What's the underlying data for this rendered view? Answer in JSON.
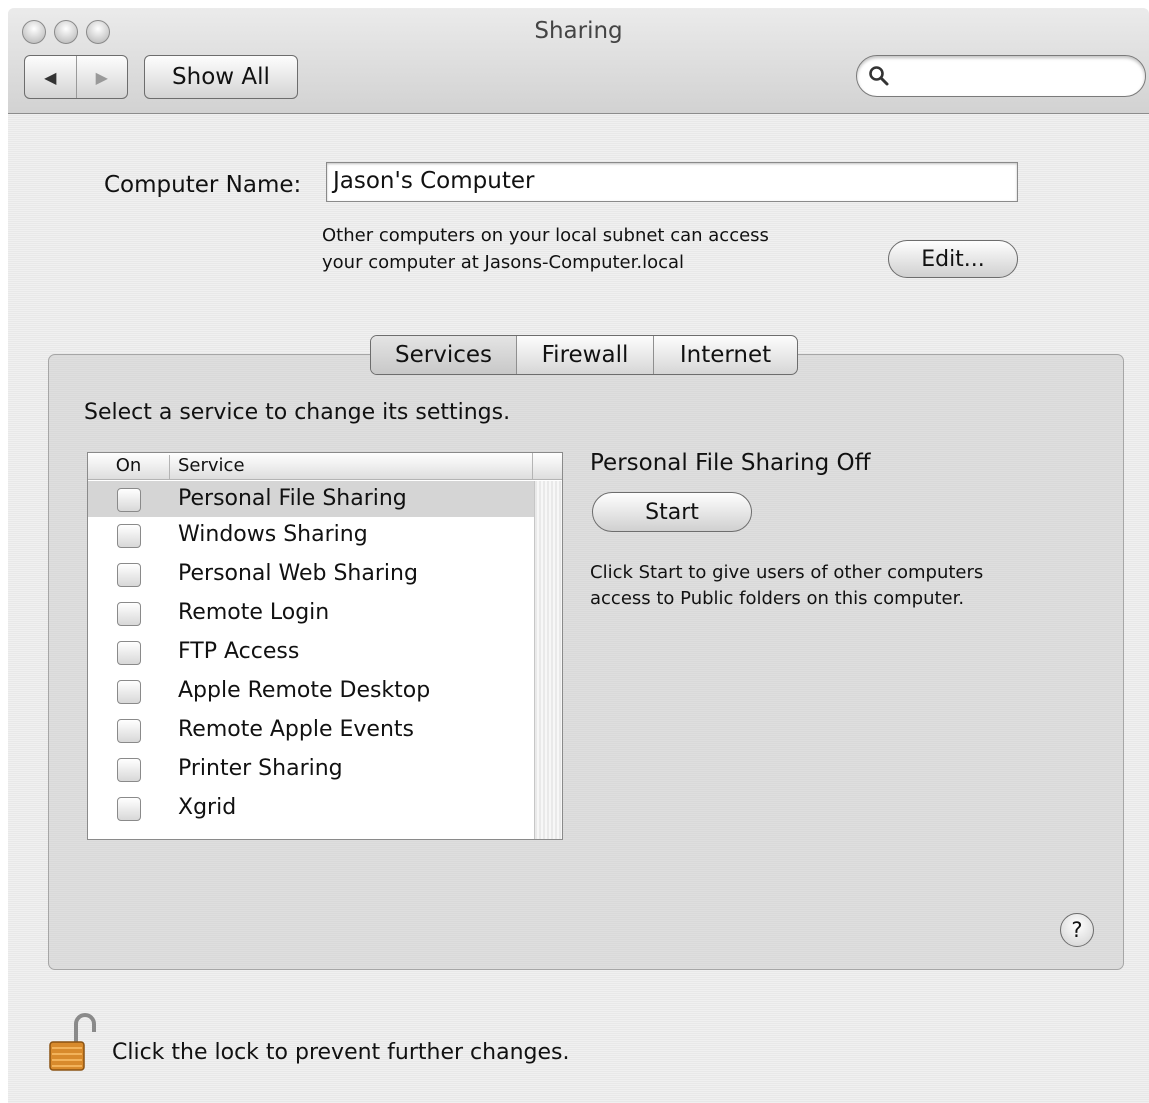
{
  "window": {
    "title": "Sharing"
  },
  "toolbar": {
    "back_glyph": "◀",
    "forward_glyph": "▶",
    "show_all_label": "Show All",
    "search_placeholder": ""
  },
  "computer_name": {
    "label": "Computer Name:",
    "value": "Jason's Computer",
    "subnet_line1": "Other computers on your local subnet can access",
    "subnet_line2": "your computer at Jasons-Computer.local",
    "edit_label": "Edit..."
  },
  "tabs": [
    {
      "label": "Services",
      "active": true
    },
    {
      "label": "Firewall",
      "active": false
    },
    {
      "label": "Internet",
      "active": false
    }
  ],
  "services_panel": {
    "instruction": "Select a service to change its settings.",
    "column_on": "On",
    "column_service": "Service",
    "services": [
      {
        "name": "Personal File Sharing",
        "on": false,
        "selected": true
      },
      {
        "name": "Windows Sharing",
        "on": false,
        "selected": false
      },
      {
        "name": "Personal Web Sharing",
        "on": false,
        "selected": false
      },
      {
        "name": "Remote Login",
        "on": false,
        "selected": false
      },
      {
        "name": "FTP Access",
        "on": false,
        "selected": false
      },
      {
        "name": "Apple Remote Desktop",
        "on": false,
        "selected": false
      },
      {
        "name": "Remote Apple Events",
        "on": false,
        "selected": false
      },
      {
        "name": "Printer Sharing",
        "on": false,
        "selected": false
      },
      {
        "name": "Xgrid",
        "on": false,
        "selected": false
      }
    ],
    "status_title": "Personal File Sharing Off",
    "start_label": "Start",
    "description_line1": "Click Start to give users of other computers",
    "description_line2": "access to Public folders on this computer."
  },
  "help": {
    "label": "?"
  },
  "footer": {
    "lock_text": "Click the lock to prevent further changes."
  },
  "icons": {
    "search": "search-icon",
    "lock": "unlocked-padlock-icon",
    "help": "help-icon"
  }
}
